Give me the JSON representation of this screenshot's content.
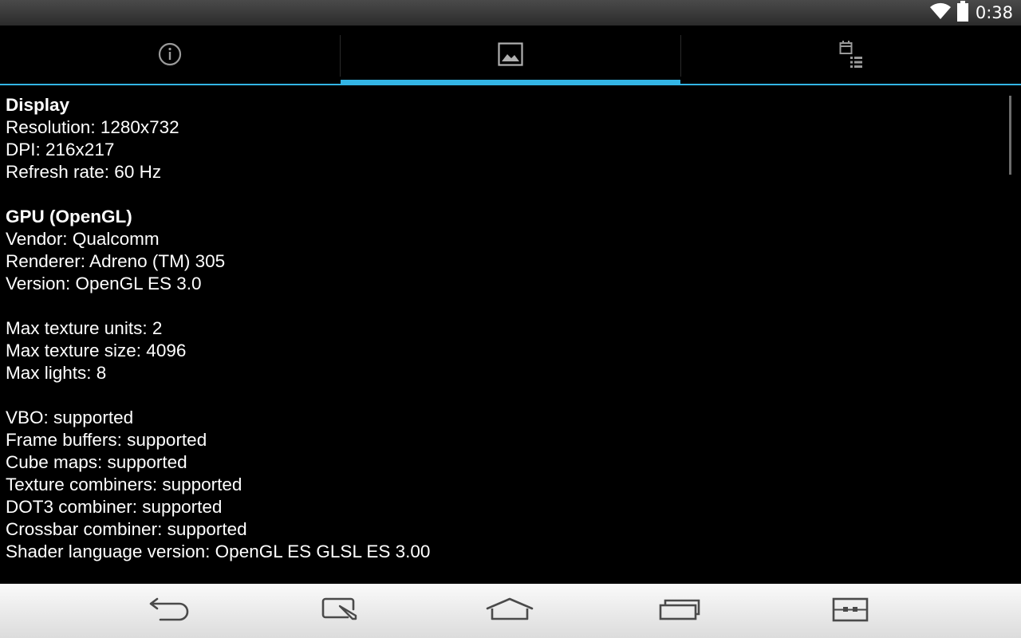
{
  "status_bar": {
    "time": "0:38",
    "icons": [
      "wifi-icon",
      "battery-icon"
    ]
  },
  "tabs": [
    {
      "name": "info",
      "icon": "info-icon",
      "selected": false
    },
    {
      "name": "display",
      "icon": "image-icon",
      "selected": true
    },
    {
      "name": "features",
      "icon": "calendar-list-icon",
      "selected": false
    }
  ],
  "colors": {
    "accent": "#33b5e5",
    "background": "#000000",
    "text": "#ffffff"
  },
  "content": {
    "display_heading": "Display",
    "resolution": "Resolution: 1280x732",
    "dpi": "DPI: 216x217",
    "refresh_rate": "Refresh rate: 60 Hz",
    "gpu_heading": "GPU (OpenGL)",
    "vendor": "Vendor: Qualcomm",
    "renderer": "Renderer: Adreno (TM) 305",
    "version": "Version: OpenGL ES 3.0",
    "max_texture_units": "Max texture units: 2",
    "max_texture_size": "Max texture size: 4096",
    "max_lights": "Max lights: 8",
    "vbo": "VBO: supported",
    "frame_buffers": "Frame buffers: supported",
    "cube_maps": "Cube maps: supported",
    "texture_combiners": "Texture combiners: supported",
    "dot3_combiner": "DOT3 combiner: supported",
    "crossbar_combiner": "Crossbar combiner: supported",
    "shader_language": "Shader language version: OpenGL ES GLSL ES 3.00"
  },
  "nav_bar": {
    "buttons": [
      "back-icon",
      "quick-memo-icon",
      "home-icon",
      "recent-apps-icon",
      "dual-window-icon"
    ]
  }
}
